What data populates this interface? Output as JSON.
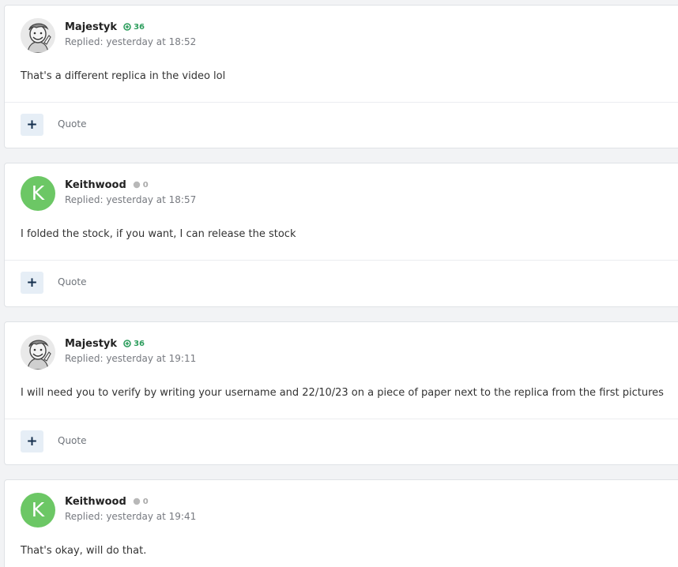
{
  "colors": {
    "avatar_green": "#6cc765",
    "rep_positive": "#2e9e5e",
    "rep_neutral": "#aaaaaa",
    "button_bg": "#e6eef6"
  },
  "posts": [
    {
      "author": "Majestyk",
      "avatar": {
        "type": "image",
        "icon": "vault-boy-avatar-icon"
      },
      "reputation": "36",
      "reputation_type": "positive",
      "reply_meta": "Replied: yesterday at 18:52",
      "body": "That's a different replica in the video lol",
      "add_label": "+",
      "quote_label": "Quote"
    },
    {
      "author": "Keithwood",
      "avatar": {
        "type": "letter",
        "letter": "K"
      },
      "reputation": "0",
      "reputation_type": "neutral",
      "reply_meta": "Replied: yesterday at 18:57",
      "body": "I folded the stock, if you want, I can release the stock",
      "add_label": "+",
      "quote_label": "Quote"
    },
    {
      "author": "Majestyk",
      "avatar": {
        "type": "image",
        "icon": "vault-boy-avatar-icon"
      },
      "reputation": "36",
      "reputation_type": "positive",
      "reply_meta": "Replied: yesterday at 19:11",
      "body": "I will need you to verify by writing your username and 22/10/23 on a piece of paper next to the replica from the first pictures",
      "add_label": "+",
      "quote_label": "Quote"
    },
    {
      "author": "Keithwood",
      "avatar": {
        "type": "letter",
        "letter": "K"
      },
      "reputation": "0",
      "reputation_type": "neutral",
      "reply_meta": "Replied: yesterday at 19:41",
      "body": "That's okay, will do that.",
      "add_label": "+",
      "quote_label": "Quote"
    }
  ]
}
